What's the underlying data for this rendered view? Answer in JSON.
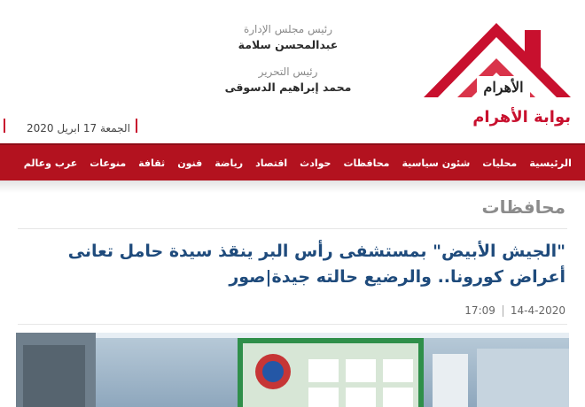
{
  "header": {
    "board_chair_title": "رئيس مجلس الإدارة",
    "board_chair_name": "عبدالمحسن سلامة",
    "editor_title": "رئيس التحرير",
    "editor_name": "محمد إبراهيم الدسوقى",
    "date": "الجمعة 17 ابريل 2020",
    "logo_text": "بوابة الأهرام",
    "logo_arabic_mark": "الأهرام"
  },
  "nav": {
    "items": [
      "الرئيسية",
      "محليات",
      "شئون سياسية",
      "محافظات",
      "حوادث",
      "اقتصاد",
      "رياضة",
      "فنون",
      "ثقافة",
      "منوعات",
      "عرب وعالم"
    ]
  },
  "section": {
    "title": "محافظات"
  },
  "article": {
    "headline": "\"الجيش الأبيض\" بمستشفى رأس البر ينقذ سيدة حامل تعانى أعراض كورونا.. والرضيع حالته جيدة|صور",
    "date": "14-4-2020",
    "time": "17:09"
  },
  "colors": {
    "brand_red": "#b3121f",
    "headline_blue": "#1f4b7c",
    "section_gray": "#8c8c8c"
  }
}
